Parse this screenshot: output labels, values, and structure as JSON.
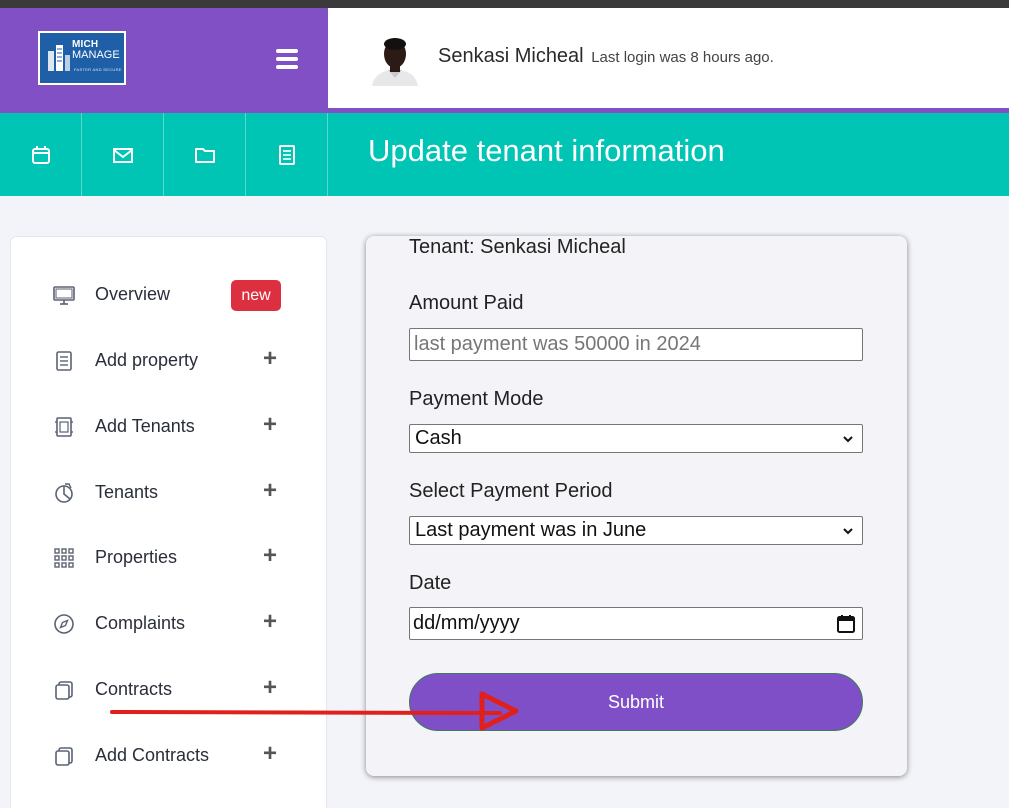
{
  "brand": {
    "logo_line1": "MICH",
    "logo_line2": "MANAGE",
    "logo_tagline": "FASTER AND SECURE"
  },
  "header": {
    "user_name": "Senkasi Micheal",
    "last_login": "Last login was 8 hours ago.",
    "page_title": "Update tenant information"
  },
  "toolbar": {
    "icons": [
      "calendar-icon",
      "mail-icon",
      "folder-icon",
      "document-icon"
    ]
  },
  "sidebar": {
    "items": [
      {
        "label": "Overview",
        "icon": "monitor-icon",
        "badge": "new"
      },
      {
        "label": "Add property",
        "icon": "document-icon"
      },
      {
        "label": "Add Tenants",
        "icon": "tenant-card-icon"
      },
      {
        "label": "Tenants",
        "icon": "pie-chart-icon"
      },
      {
        "label": "Properties",
        "icon": "grid-icon"
      },
      {
        "label": "Complaints",
        "icon": "compass-icon"
      },
      {
        "label": "Contracts",
        "icon": "copy-icon"
      },
      {
        "label": "Add Contracts",
        "icon": "copy-icon"
      }
    ],
    "plus_symbol": "+"
  },
  "form": {
    "tenant_label": "Tenant: Senkasi Micheal",
    "amount_label": "Amount Paid",
    "amount_placeholder": "last payment was 50000 in 2024",
    "mode_label": "Payment Mode",
    "mode_value": "Cash",
    "period_label": "Select Payment Period",
    "period_value": "Last payment was in June",
    "date_label": "Date",
    "date_placeholder": "dd/mm/yyyy",
    "submit_label": "Submit"
  },
  "colors": {
    "brand_purple": "#8050c4",
    "teal": "#00c4b4",
    "badge_red": "#dc2f3f",
    "annotation_red": "#e0201c"
  }
}
